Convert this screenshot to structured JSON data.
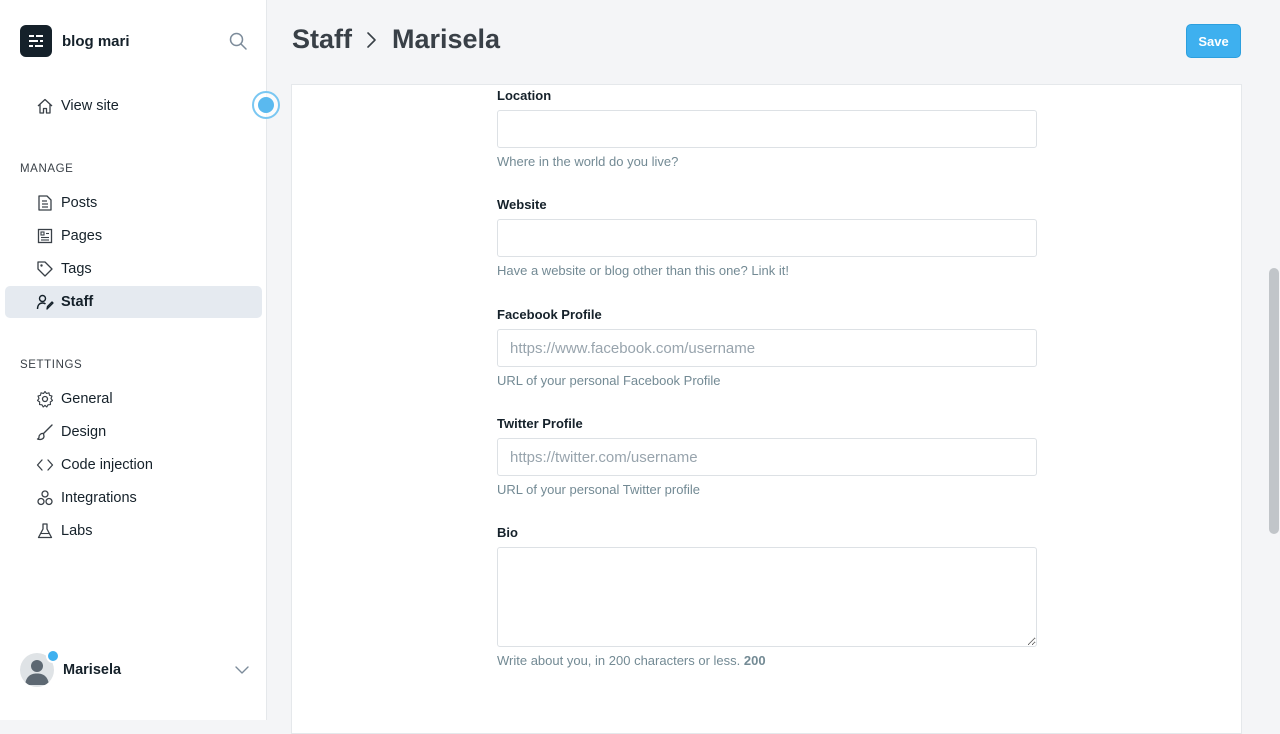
{
  "sidebar": {
    "brand_name": "blog mari",
    "view_site": "View site",
    "manage_title": "MANAGE",
    "manage_items": [
      {
        "label": "Posts",
        "icon": "posts-icon"
      },
      {
        "label": "Pages",
        "icon": "pages-icon"
      },
      {
        "label": "Tags",
        "icon": "tag-icon"
      },
      {
        "label": "Staff",
        "icon": "staff-icon",
        "active": true
      }
    ],
    "settings_title": "SETTINGS",
    "settings_items": [
      {
        "label": "General",
        "icon": "gear-icon"
      },
      {
        "label": "Design",
        "icon": "brush-icon"
      },
      {
        "label": "Code injection",
        "icon": "code-icon"
      },
      {
        "label": "Integrations",
        "icon": "integrations-icon"
      },
      {
        "label": "Labs",
        "icon": "flask-icon"
      }
    ],
    "user_name": "Marisela"
  },
  "header": {
    "crumb_parent": "Staff",
    "crumb_current": "Marisela",
    "save_label": "Save"
  },
  "form": {
    "location": {
      "label": "Location",
      "value": "",
      "placeholder": "",
      "hint": "Where in the world do you live?"
    },
    "website": {
      "label": "Website",
      "value": "",
      "placeholder": "",
      "hint": "Have a website or blog other than this one? Link it!"
    },
    "facebook": {
      "label": "Facebook Profile",
      "value": "",
      "placeholder": "https://www.facebook.com/username",
      "hint": "URL of your personal Facebook Profile"
    },
    "twitter": {
      "label": "Twitter Profile",
      "value": "",
      "placeholder": "https://twitter.com/username",
      "hint": "URL of your personal Twitter profile"
    },
    "bio": {
      "label": "Bio",
      "value": "",
      "hint": "Write about you, in 200 characters or less.",
      "char_count": "200"
    }
  },
  "colors": {
    "accent": "#3eb0ef",
    "sidebar_active": "#e5eaf0",
    "text": "#15212a",
    "hint": "#738a94"
  }
}
